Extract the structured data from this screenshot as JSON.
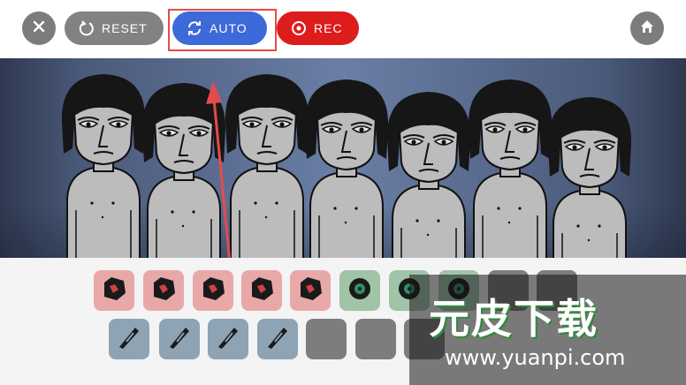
{
  "toolbar": {
    "close_icon": "close-icon",
    "reset_label": "RESET",
    "auto_label": "AUTO",
    "rec_label": "REC",
    "home_icon": "home-icon",
    "colors": {
      "reset": "#828282",
      "auto": "#3c6ad8",
      "rec": "#dd1c1c",
      "highlight": "#e64b4b"
    }
  },
  "stage": {
    "character_count": 7
  },
  "palette": {
    "row1": [
      {
        "name": "beat-icon-1",
        "kind": "red"
      },
      {
        "name": "beat-icon-2",
        "kind": "red"
      },
      {
        "name": "beat-icon-3",
        "kind": "red"
      },
      {
        "name": "beat-icon-4",
        "kind": "red"
      },
      {
        "name": "beat-icon-5",
        "kind": "red"
      },
      {
        "name": "effect-icon-1",
        "kind": "green"
      },
      {
        "name": "effect-icon-2",
        "kind": "green"
      },
      {
        "name": "effect-icon-3",
        "kind": "green"
      },
      {
        "name": "melody-icon-1",
        "kind": "grey"
      },
      {
        "name": "melody-icon-2",
        "kind": "grey"
      }
    ],
    "row2": [
      {
        "name": "melody-icon-3",
        "kind": "blue"
      },
      {
        "name": "melody-icon-4",
        "kind": "blue"
      },
      {
        "name": "melody-icon-5",
        "kind": "blue"
      },
      {
        "name": "melody-icon-6",
        "kind": "blue"
      },
      {
        "name": "voice-icon-1",
        "kind": "grey"
      },
      {
        "name": "voice-icon-2",
        "kind": "grey"
      },
      {
        "name": "voice-icon-3",
        "kind": "grey"
      }
    ]
  },
  "watermark": {
    "title": "元皮下载",
    "url": "www.yuanpi.com"
  }
}
